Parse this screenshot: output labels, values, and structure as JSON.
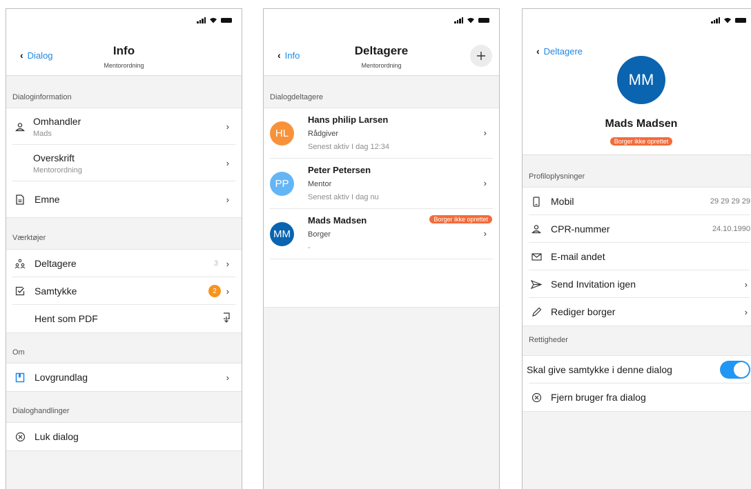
{
  "s1": {
    "back": "Dialog",
    "title": "Info",
    "subtitle": "Mentorordning",
    "sec_info": "Dialoginformation",
    "omhandler": {
      "label": "Omhandler",
      "value": "Mads"
    },
    "overskrift": {
      "label": "Overskrift",
      "value": "Mentorordning"
    },
    "emne": "Emne",
    "sec_tools": "Værktøjer",
    "deltagere": {
      "label": "Deltagere",
      "count": "3"
    },
    "samtykke": {
      "label": "Samtykke",
      "badge": "2"
    },
    "pdf": "Hent som PDF",
    "sec_om": "Om",
    "lovgrundlag": "Lovgrundlag",
    "sec_actions": "Dialoghandlinger",
    "luk": "Luk dialog"
  },
  "s2": {
    "back": "Info",
    "title": "Deltagere",
    "subtitle": "Mentorordning",
    "sec": "Dialogdeltagere",
    "participants": [
      {
        "initials": "HL",
        "name": "Hans philip Larsen",
        "role": "Rådgiver",
        "status": "Senest aktiv I dag 12:34",
        "color": "#f7923a"
      },
      {
        "initials": "PP",
        "name": "Peter Petersen",
        "role": "Mentor",
        "status": "Senest aktiv I dag nu",
        "color": "#64b5f6"
      },
      {
        "initials": "MM",
        "name": "Mads Madsen",
        "role": "Borger",
        "status": "-",
        "color": "#0a64b0",
        "label": "Borger ikke oprettet"
      }
    ]
  },
  "s3": {
    "back": "Deltagere",
    "initials": "MM",
    "avatar_color": "#0a64b0",
    "name": "Mads Madsen",
    "badge": "Borger ikke oprettet",
    "sec_profile": "Profiloplysninger",
    "mobil": {
      "label": "Mobil",
      "value": "29 29 29 29"
    },
    "cpr": {
      "label": "CPR-nummer",
      "value": "24.10.1990"
    },
    "email": "E-mail andet",
    "invite": "Send Invitation igen",
    "edit": "Rediger borger",
    "sec_rights": "Rettigheder",
    "consent": "Skal give samtykke i denne dialog",
    "remove": "Fjern bruger fra dialog"
  },
  "colors": {
    "accent": "#1e88e5",
    "orange": "#f26b3a",
    "badge": "#f7941d"
  },
  "icons": [
    "back-chevron-icon",
    "signal-icon",
    "wifi-icon",
    "battery-icon",
    "person-icon",
    "document-icon",
    "group-icon",
    "check-square-icon",
    "download-icon",
    "book-icon",
    "close-circle-icon",
    "plus-icon",
    "phone-icon",
    "mail-icon",
    "send-icon",
    "pencil-icon",
    "chevron-right-icon"
  ]
}
